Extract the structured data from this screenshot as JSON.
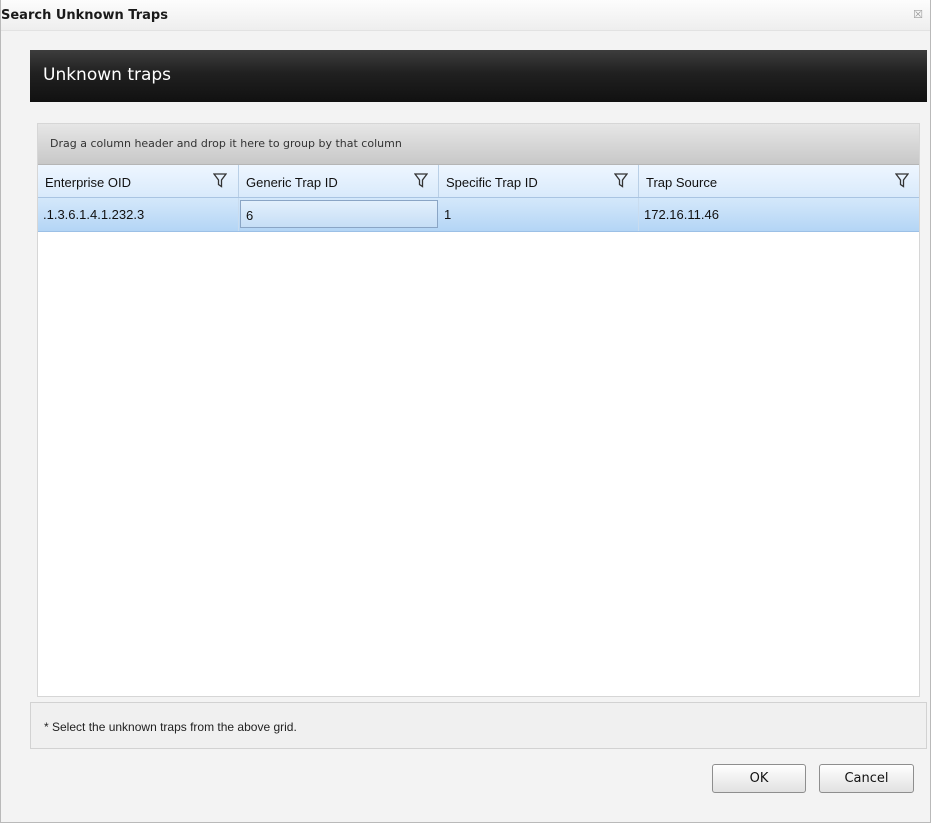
{
  "window": {
    "title": "Search Unknown Traps",
    "close_glyph": "☒"
  },
  "banner": {
    "title": "Unknown traps"
  },
  "grid": {
    "group_hint": "Drag a column header and drop it here to group by that column",
    "columns": [
      {
        "label": "Enterprise OID",
        "filter_icon": "filter-icon"
      },
      {
        "label": "Generic Trap ID",
        "filter_icon": "filter-icon"
      },
      {
        "label": "Specific Trap ID",
        "filter_icon": "filter-icon"
      },
      {
        "label": "Trap Source",
        "filter_icon": "filter-icon"
      }
    ],
    "rows": [
      {
        "enterprise_oid": ".1.3.6.1.4.1.232.3",
        "generic_trap_id": "6",
        "specific_trap_id": "1",
        "trap_source": "172.16.11.46"
      }
    ]
  },
  "note": "* Select the unknown traps from the above grid.",
  "buttons": {
    "ok": "OK",
    "cancel": "Cancel"
  },
  "colors": {
    "banner_bg": "#1e1e1e",
    "header_bg": "#d9eafb",
    "selected_row_bg": "#b4d5f5"
  }
}
